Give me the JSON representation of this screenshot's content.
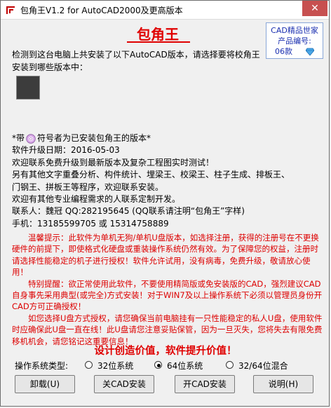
{
  "window": {
    "title": "包角王V1.2 for AutoCAD2000及更高版本",
    "close_label": "✕"
  },
  "brand": {
    "name": "包角王"
  },
  "promo": {
    "line1": "CAD精品世家",
    "line2": "产品编号:",
    "line3": "06款"
  },
  "intro": {
    "text": "检测到这台电脑上共安装了以下AutoCAD版本，请选择要将校角王安装到哪些版本中："
  },
  "info": {
    "legend_prefix": "*带",
    "legend_suffix": "符号者为已安装包角王的版本*",
    "lines": [
      "软件升级日期：2016-05-03",
      "欢迎联系免费升级到最新版本及复杂工程图实时测试！",
      "另有其他文字重叠分析、构件统计、埋梁王、校梁王、柱子生成、排板王、",
      "门钢王、拼板王等程序，欢迎联系安装。",
      "欢迎有其他专业编程需求的人联系定制开发。",
      "联系人：魏冠 QQ:282195645 (QQ联系请注明“包角王”字样)",
      "手机：13185599705 或 15314758889"
    ]
  },
  "notice": {
    "paragraphs": [
      "温馨提示：此软件为单机无狗/单机U盘版本，如选择注册，获得的注册号在不更换硬件的前提下，即使格式化硬盘或重装操作系统仍然有效。为了保障您的权益，注册时请选择性能稳定的机子进行授权！软件允许试用，没有病毒，免费升级，敬请放心使用！",
      "特别提醒：欲正常使用此软件，不要使用精简版或免安装版的CAD，强烈建议CAD自身事先采用典型(或完全)方式安装！对于WIN7及以上操作系统下必须以管理员身份开CAD方可正确授权！",
      "如您选择U盘方式授权，请您确保当前电脑挂有一只性能稳定的私人U盘，使用软件时应确保此U盘一直在线！此U盘请您注意妥贴保管，因为一旦灭失，您将失去有限免费移机机会，请您铭记这重要信息！"
    ]
  },
  "slogan": "设计创造价值，软件提升价值！",
  "os": {
    "label": "操作系统类型:",
    "options": [
      "32位系统",
      "64位系统",
      "32/64位混合"
    ],
    "selected": "64位系统"
  },
  "buttons": {
    "uninstall": "卸载(U)",
    "close_cad_install": "关CAD安装",
    "open_cad_install": "开CAD安装",
    "help": "说明(H)"
  },
  "colors": {
    "accent_red": "#e00000",
    "promo_blue": "#1a2fb0",
    "close_red": "#c75050"
  },
  "icons": {
    "app": "corner-app-icon",
    "cd": "cd-disc-icon",
    "diamond": "diamond-icon"
  }
}
